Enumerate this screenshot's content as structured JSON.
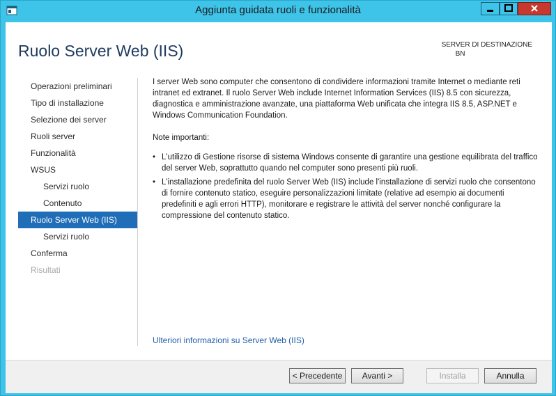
{
  "window": {
    "title": "Aggiunta guidata ruoli e funzionalità",
    "colors": {
      "frame": "#3ec3e9",
      "close": "#c7382f",
      "accent": "#1f6eb7"
    }
  },
  "header": {
    "page_title": "Ruolo Server Web (IIS)",
    "destination_label": "SERVER DI DESTINAZIONE",
    "destination_server": "BN"
  },
  "nav": {
    "items": [
      {
        "label": "Operazioni preliminari",
        "state": "normal",
        "level": 0
      },
      {
        "label": "Tipo di installazione",
        "state": "normal",
        "level": 0
      },
      {
        "label": "Selezione dei server",
        "state": "normal",
        "level": 0
      },
      {
        "label": "Ruoli server",
        "state": "normal",
        "level": 0
      },
      {
        "label": "Funzionalità",
        "state": "normal",
        "level": 0
      },
      {
        "label": "WSUS",
        "state": "normal",
        "level": 0
      },
      {
        "label": "Servizi ruolo",
        "state": "normal",
        "level": 1
      },
      {
        "label": "Contenuto",
        "state": "normal",
        "level": 1
      },
      {
        "label": "Ruolo Server Web (IIS)",
        "state": "active",
        "level": 0
      },
      {
        "label": "Servizi ruolo",
        "state": "normal",
        "level": 1
      },
      {
        "label": "Conferma",
        "state": "normal",
        "level": 0
      },
      {
        "label": "Risultati",
        "state": "disabled",
        "level": 0
      }
    ]
  },
  "content": {
    "intro": "I server Web sono computer che consentono di condividere informazioni tramite Internet o mediante reti intranet ed extranet. Il ruolo Server Web include Internet Information Services (IIS) 8.5 con sicurezza, diagnostica e amministrazione avanzate, una piattaforma Web unificata che integra IIS 8.5, ASP.NET e Windows Communication Foundation.",
    "notes_title": "Note importanti:",
    "notes": [
      "L'utilizzo di Gestione risorse di sistema Windows consente di garantire una gestione equilibrata del traffico del server Web, soprattutto quando nel computer sono presenti più ruoli.",
      "L'installazione predefinita del ruolo Server Web (IIS) include l'installazione di servizi ruolo che consentono di fornire contenuto statico, eseguire personalizzazioni limitate (relative ad esempio ai documenti predefiniti e agli errori HTTP), monitorare e registrare le attività del server nonché configurare la compressione del contenuto statico."
    ],
    "more_link": "Ulteriori informazioni su Server Web (IIS)"
  },
  "footer": {
    "prev": "< Precedente",
    "next": "Avanti >",
    "install": "Installa",
    "cancel": "Annulla"
  }
}
